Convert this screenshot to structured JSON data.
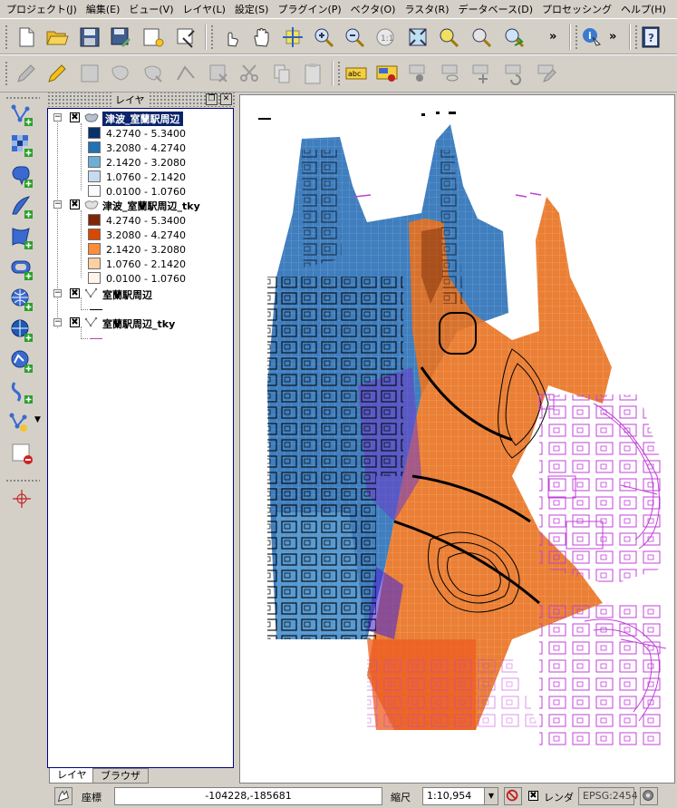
{
  "menubar": {
    "items": [
      "プロジェクト(J)",
      "編集(E)",
      "ビュー(V)",
      "レイヤ(L)",
      "設定(S)",
      "プラグイン(P)",
      "ベクタ(O)",
      "ラスタ(R)",
      "データベース(D)",
      "プロセッシング",
      "ヘルプ(H)"
    ]
  },
  "toolbar_icons": {
    "file": [
      "new-project-icon",
      "open-project-icon",
      "save-project-icon",
      "save-as-icon",
      "new-print-composer-icon",
      "composer-manager-icon"
    ],
    "nav": [
      "touch-zoom-icon",
      "pan-icon",
      "pan-to-selection-icon",
      "zoom-in-icon",
      "zoom-out-icon",
      "zoom-actual-icon",
      "zoom-full-icon",
      "zoom-to-layer-icon",
      "zoom-to-selection-icon",
      "zoom-last-icon"
    ],
    "more": "»",
    "identify": "identify-icon",
    "help": "help-icon"
  },
  "layers_panel": {
    "title": "レイヤ",
    "tabs": {
      "layers": "レイヤ",
      "browser": "ブラウザ"
    },
    "layers": [
      {
        "name": "津波_室蘭駅周辺",
        "selected": true,
        "checked": "✖",
        "legend": [
          {
            "label": "4.2740 - 5.3400",
            "color": "#08306b"
          },
          {
            "label": "3.2080 - 4.2740",
            "color": "#2171b5"
          },
          {
            "label": "2.1420 - 3.2080",
            "color": "#6baed6"
          },
          {
            "label": "1.0760 - 2.1420",
            "color": "#c6dbef"
          },
          {
            "label": "0.0100 - 1.0760",
            "color": "#f7fbff"
          }
        ]
      },
      {
        "name": "津波_室蘭駅周辺_tky",
        "selected": false,
        "checked": "✖",
        "legend": [
          {
            "label": "4.2740 - 5.3400",
            "color": "#7f2704"
          },
          {
            "label": "3.2080 - 4.2740",
            "color": "#d94801"
          },
          {
            "label": "2.1420 - 3.2080",
            "color": "#fd8d3c"
          },
          {
            "label": "1.0760 - 2.1420",
            "color": "#fdd0a2"
          },
          {
            "label": "0.0100 - 1.0760",
            "color": "#fff5eb"
          }
        ]
      },
      {
        "name": "室蘭駅周辺",
        "selected": false,
        "checked": "✖",
        "line_color": "#000000"
      },
      {
        "name": "室蘭駅周辺_tky",
        "selected": false,
        "checked": "✖",
        "line_color": "#c040c0"
      }
    ]
  },
  "statusbar": {
    "coord_label": "座標",
    "coord_value": "-104228,-185681",
    "scale_label": "縮尺",
    "scale_value": "1:10,954",
    "render_label": "レンダ",
    "render_checked": "✖",
    "crs": "EPSG:2454"
  }
}
